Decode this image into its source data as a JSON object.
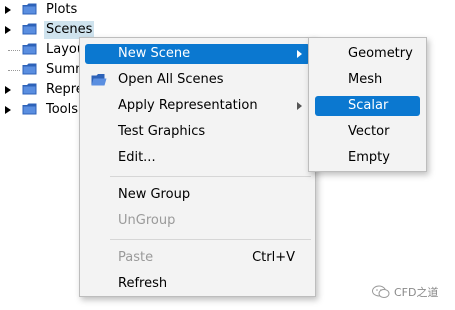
{
  "tree": {
    "items": [
      {
        "label": "Plots",
        "expandable": true
      },
      {
        "label": "Scenes",
        "expandable": true,
        "selected": true
      },
      {
        "label": "Layou",
        "expandable": false
      },
      {
        "label": "Summ",
        "expandable": false
      },
      {
        "label": "Repre",
        "expandable": true
      },
      {
        "label": "Tools",
        "expandable": true
      }
    ]
  },
  "context_menu": {
    "items": {
      "new_scene": "New Scene",
      "open_all_scenes": "Open All Scenes",
      "apply_representation": "Apply Representation",
      "test_graphics": "Test Graphics",
      "edit": "Edit...",
      "new_group": "New Group",
      "ungroup": "UnGroup",
      "paste": "Paste",
      "paste_shortcut": "Ctrl+V",
      "refresh": "Refresh"
    }
  },
  "submenu": {
    "items": [
      "Geometry",
      "Mesh",
      "Scalar",
      "Vector",
      "Empty"
    ],
    "highlighted": "Scalar"
  },
  "watermark": {
    "text": "CFD之道"
  },
  "colors": {
    "highlight": "#0b78d0",
    "selection": "#cfe3ee",
    "folder": "#2d62b8"
  }
}
